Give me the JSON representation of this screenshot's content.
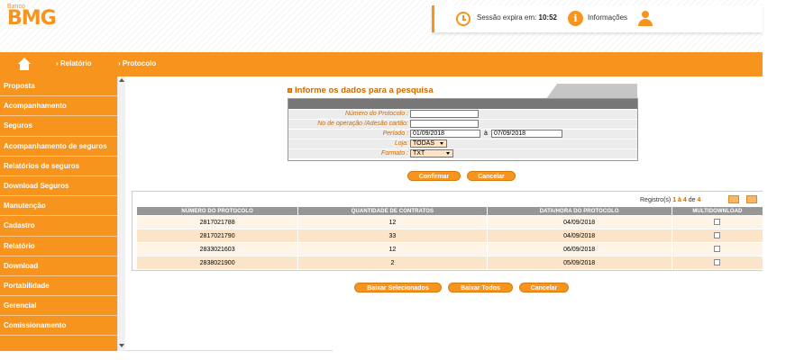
{
  "header": {
    "logo_small": "Banco",
    "logo_big": "BMG",
    "session_label": "Sessão expira em:",
    "session_time": "10:52",
    "info_label": "Informações"
  },
  "nav": {
    "items": [
      {
        "label": "Relatório"
      },
      {
        "label": "Protocolo"
      }
    ]
  },
  "sidebar": {
    "items": [
      {
        "label": "Proposta"
      },
      {
        "label": "Acompanhamento"
      },
      {
        "label": "Seguros"
      },
      {
        "label": "Acompanhamento de seguros"
      },
      {
        "label": "Relatórios de seguros"
      },
      {
        "label": "Download Seguros"
      },
      {
        "label": "Manutenção"
      },
      {
        "label": "Cadastro"
      },
      {
        "label": "Relatório"
      },
      {
        "label": "Download"
      },
      {
        "label": "Portabilidade"
      },
      {
        "label": "Gerencial"
      },
      {
        "label": "Comissionamento"
      }
    ]
  },
  "form": {
    "title": "Informe os dados para a pesquisa",
    "protocol_label": "Número do Protocolo :",
    "protocol_value": "",
    "operation_label": "No de operação /Adesão cartão:",
    "operation_value": "",
    "period_label": "Período :",
    "period_start": "01/09/2018",
    "period_sep": "à",
    "period_end": "07/09/2018",
    "store_label": "Loja:",
    "store_value": "TODAS",
    "format_label": "Formato :",
    "format_value": "TXT",
    "confirm_label": "Confirmar",
    "cancel_label": "Cancelar"
  },
  "results": {
    "reg_prefix": "Registro(s)",
    "reg_from": "1",
    "reg_mid": "à",
    "reg_to": "4",
    "reg_de": "de",
    "reg_total": "4",
    "columns": [
      "NÚMERO DO PROTOCOLO",
      "QUANTIDADE DE CONTRATOS",
      "DATA/HORA DO PROTOCOLO",
      "MULTIDOWNLOAD"
    ],
    "rows": [
      {
        "protocolo": "2817021788",
        "quantidade": "12",
        "data": "04/09/2018"
      },
      {
        "protocolo": "2817021790",
        "quantidade": "33",
        "data": "04/09/2018"
      },
      {
        "protocolo": "2833021603",
        "quantidade": "12",
        "data": "06/09/2018"
      },
      {
        "protocolo": "2838021900",
        "quantidade": "2",
        "data": "05/09/2018"
      }
    ],
    "download_selected_label": "Baixar Selecionados",
    "download_all_label": "Baixar Todos",
    "cancel_label": "Cancelar"
  },
  "colors": {
    "brand": "#f7941d",
    "brand_dark": "#cc6a00",
    "header_gray": "#969696"
  }
}
